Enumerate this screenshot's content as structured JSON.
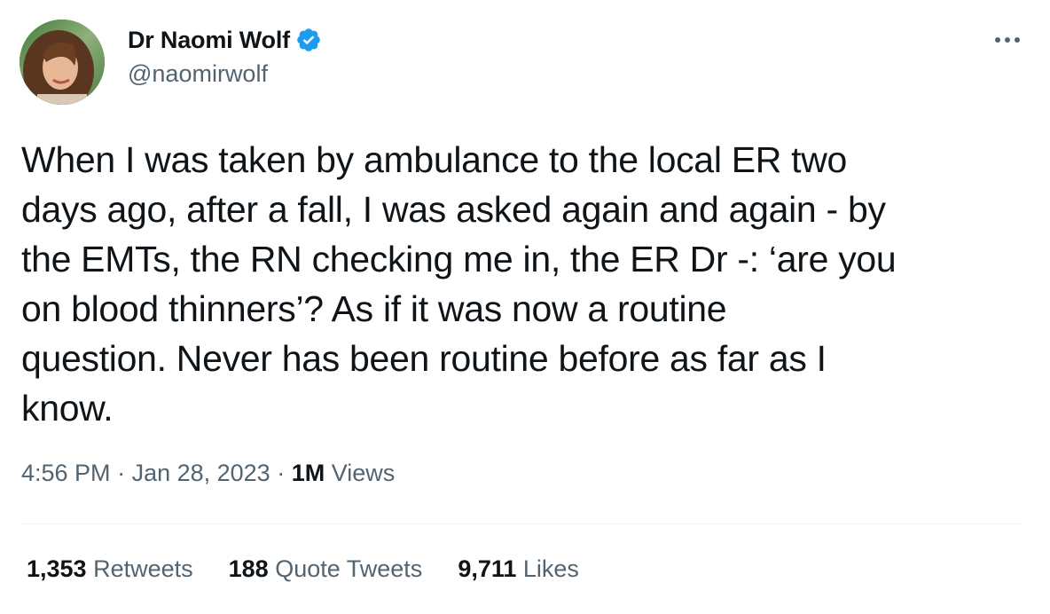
{
  "author": {
    "display_name": "Dr Naomi Wolf",
    "handle": "@naomirwolf",
    "verified": true,
    "verified_color": "#1d9bf0"
  },
  "tweet": {
    "text": "When I was taken by ambulance to the local ER two\ndays ago, after a fall, I was asked again and again - by\nthe EMTs, the RN checking me in, the ER Dr -: ‘are you\non blood thinners’? As if it was now a routine\nquestion. Never has been routine before as far as I\nknow."
  },
  "meta": {
    "time": "4:56 PM",
    "separator": " · ",
    "date": "Jan 28, 2023",
    "views_count": "1M",
    "views_label": " Views"
  },
  "stats": {
    "retweets_count": "1,353",
    "retweets_label": " Retweets",
    "quotes_count": "188",
    "quotes_label": " Quote Tweets",
    "likes_count": "9,711",
    "likes_label": " Likes"
  },
  "icons": {
    "more": "more-horizontal-icon",
    "verified": "verified-badge-icon",
    "avatar": "profile-photo"
  }
}
